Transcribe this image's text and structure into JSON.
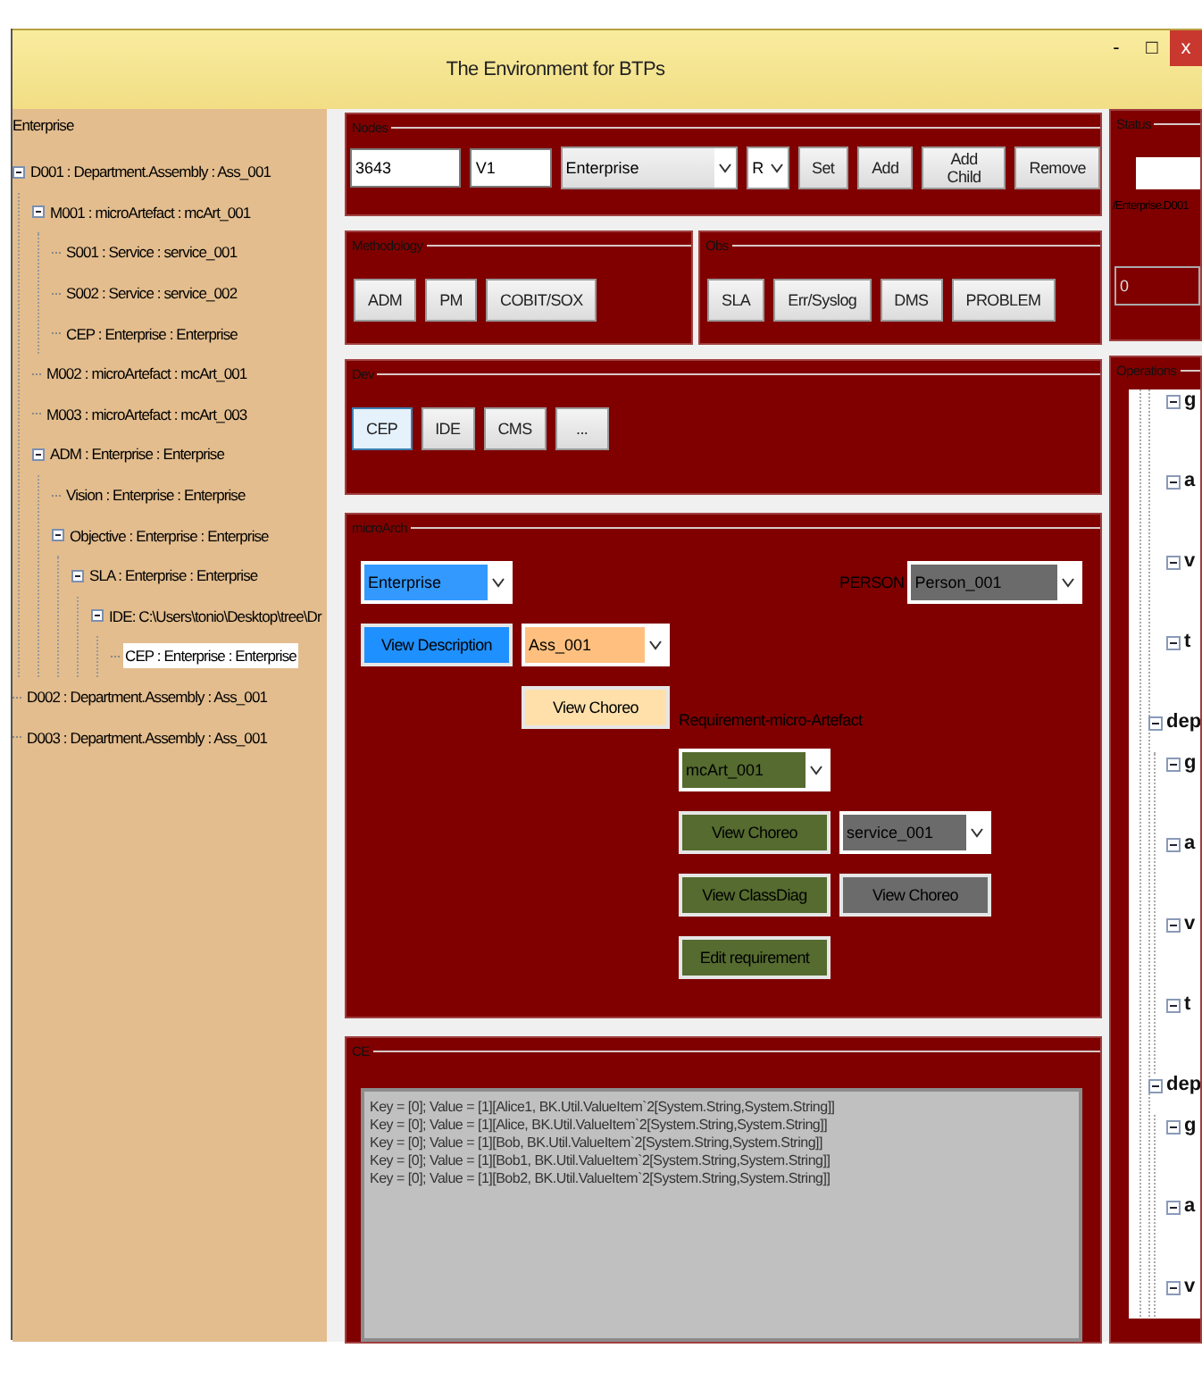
{
  "window": {
    "title": "The Environment for BTPs",
    "controls": [
      "-",
      "□",
      "x"
    ]
  },
  "tree": {
    "root": "Enterprise",
    "items": [
      {
        "label": "D001 : Department.Assembly : Ass_001",
        "expanded": true,
        "selected": false,
        "children": [
          {
            "label": "M001 : microArtefact : mcArt_001",
            "expanded": true,
            "selected": false,
            "children": [
              {
                "label": "S001 : Service : service_001",
                "selected": false
              },
              {
                "label": "S002 : Service : service_002",
                "selected": false
              },
              {
                "label": "CEP : Enterprise : Enterprise",
                "selected": false
              }
            ]
          },
          {
            "label": "M002 : microArtefact : mcArt_001",
            "selected": false
          },
          {
            "label": "M003 : microArtefact : mcArt_003",
            "selected": false
          },
          {
            "label": "ADM : Enterprise : Enterprise",
            "expanded": true,
            "selected": false,
            "children": [
              {
                "label": "Vision : Enterprise : Enterprise",
                "selected": false
              },
              {
                "label": "Objective : Enterprise : Enterprise",
                "expanded": true,
                "selected": false,
                "children": [
                  {
                    "label": "SLA : Enterprise : Enterprise",
                    "expanded": true,
                    "selected": false,
                    "children": [
                      {
                        "label": "IDE: C:\\Users\\tonio\\Desktop\\tree\\Dr",
                        "expanded": true,
                        "selected": false,
                        "children": [
                          {
                            "label": "CEP : Enterprise : Enterprise",
                            "selected": true
                          }
                        ]
                      }
                    ]
                  }
                ]
              }
            ]
          }
        ]
      },
      {
        "label": "D002 : Department.Assembly : Ass_001",
        "selected": false
      },
      {
        "label": "D003 : Department.Assembly : Ass_001",
        "selected": false
      }
    ]
  },
  "nodes": {
    "title": "Nodes",
    "id": "3643",
    "version": "V1",
    "type": "Enterprise",
    "mode": "R",
    "buttons": [
      "Set",
      "Add",
      "Add Child",
      "Remove"
    ]
  },
  "methodology": {
    "title": "Methodology",
    "buttons": [
      "ADM",
      "PM",
      "COBIT/SOX"
    ]
  },
  "obs": {
    "title": "Obs",
    "buttons": [
      "SLA",
      "Err/Syslog",
      "DMS",
      "PROBLEM"
    ]
  },
  "dev": {
    "title": "Dev",
    "buttons": [
      {
        "label": "CEP",
        "selected": true
      },
      {
        "label": "IDE",
        "selected": false
      },
      {
        "label": "CMS",
        "selected": false
      },
      {
        "label": "...",
        "selected": false
      }
    ]
  },
  "micro_arch": {
    "title": "microArch",
    "enterprise": "Enterprise",
    "person_label": "PERSON",
    "person": "Person_001",
    "view_description": "View Description",
    "assembly": "Ass_001",
    "view_choreo_assembly": "View Choreo",
    "requirement_label": "Requirement-micro-Artefact",
    "artefact": "mcArt_001",
    "view_choreo_artefact": "View Choreo",
    "service": "service_001",
    "view_class_diag": "View ClassDiag",
    "view_choreo_service": "View Choreo",
    "edit_requirement": "Edit requirement"
  },
  "ce": {
    "title": "CE",
    "lines": [
      "Key = [0]; Value = [1][Alice1, BK.Util.ValueItem`2[System.String,System.String]]",
      "Key = [0]; Value = [1][Alice, BK.Util.ValueItem`2[System.String,System.String]]",
      "Key = [0]; Value = [1][Bob, BK.Util.ValueItem`2[System.String,System.String]]",
      "Key = [0]; Value = [1][Bob1, BK.Util.ValueItem`2[System.String,System.String]]",
      "Key = [0]; Value = [1][Bob2, BK.Util.ValueItem`2[System.String,System.String]]"
    ]
  },
  "status": {
    "title": "Status",
    "path": "/Enterprise.D001",
    "value": "0"
  },
  "operations": {
    "title": "Operations",
    "items": [
      {
        "label": "g",
        "expanded": true
      },
      {
        "label": "a",
        "expanded": true
      },
      {
        "label": "v",
        "expanded": true
      },
      {
        "label": "t",
        "expanded": true
      },
      {
        "label": "dep",
        "expanded": true,
        "children": [
          {
            "label": "g",
            "expanded": true
          },
          {
            "label": "a",
            "expanded": true
          },
          {
            "label": "v",
            "expanded": true
          },
          {
            "label": "t",
            "expanded": true
          }
        ]
      },
      {
        "label": "dep",
        "expanded": true,
        "children": [
          {
            "label": "g",
            "expanded": true
          },
          {
            "label": "a",
            "expanded": true
          },
          {
            "label": "v",
            "expanded": true
          }
        ]
      }
    ]
  }
}
